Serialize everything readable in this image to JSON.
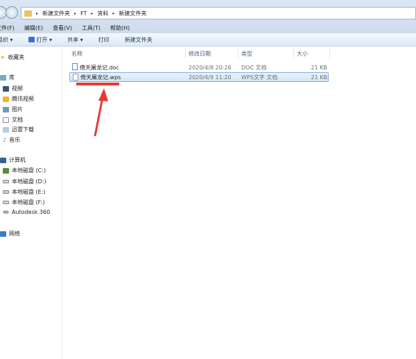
{
  "address": {
    "path": [
      "新建文件夹",
      "FT",
      "资料",
      "新建文件夹"
    ]
  },
  "menu": [
    "文件(F)",
    "编辑(E)",
    "查看(V)",
    "工具(T)",
    "帮助(H)"
  ],
  "toolbar": {
    "organize": "组织 ▾",
    "open": "打开 ▾",
    "share": "共享 ▾",
    "print": "打印",
    "new_folder": "新建文件夹"
  },
  "sidebar": {
    "favorites": "收藏夹",
    "library": "库",
    "lib_items": [
      "视频",
      "腾讯视频",
      "图片",
      "文档",
      "迅雷下载",
      "音乐"
    ],
    "computer": "计算机",
    "drives": [
      "本地磁盘 (C:)",
      "本地磁盘 (D:)",
      "本地磁盘 (E:)",
      "本地磁盘 (F:)",
      "Autodesk 360"
    ],
    "network": "网络"
  },
  "columns": {
    "name": "名称",
    "modified": "修改日期",
    "type": "类型",
    "size": "大小"
  },
  "files": [
    {
      "name": "倚天屠龙记.doc",
      "modified": "2020/4/8 20:26",
      "type": "DOC 文档",
      "size": "21 KB"
    },
    {
      "name": "倚天屠龙记.wps",
      "modified": "2020/4/9 11:20",
      "type": "WPS文字 文档",
      "size": "21 KB",
      "selected": true
    }
  ],
  "annotation_color": "#e53935"
}
